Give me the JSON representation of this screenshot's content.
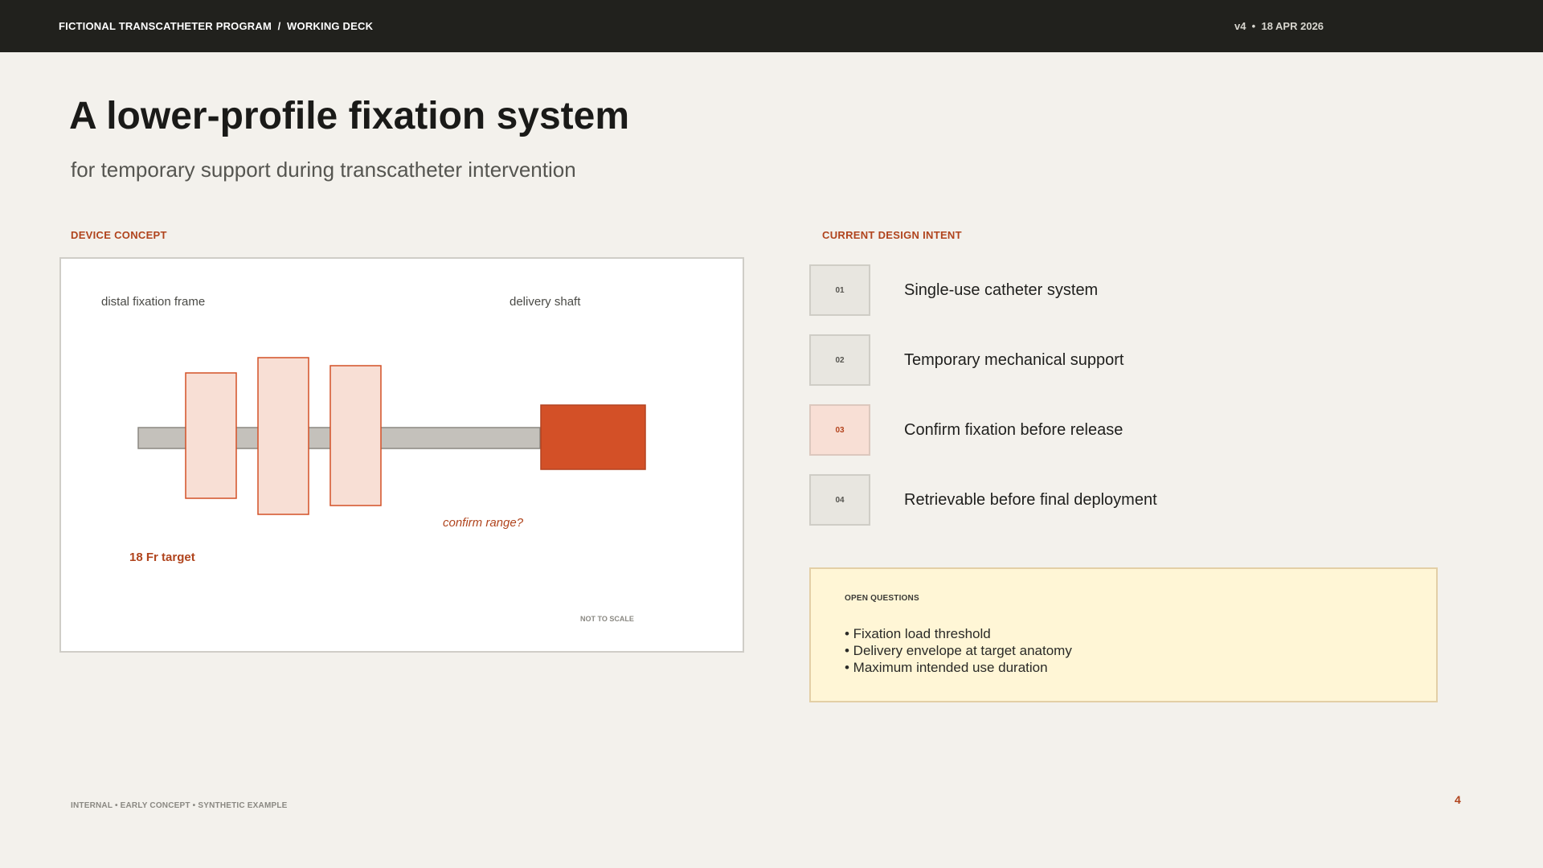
{
  "header": {
    "program": "FICTIONAL TRANSCATHETER PROGRAM  /  WORKING DECK",
    "version": "v4  •  18 APR 2026"
  },
  "slide": {
    "title": "A lower-profile fixation system",
    "subtitle": "for temporary support during transcatheter intervention"
  },
  "concept": {
    "section_label": "DEVICE CONCEPT",
    "label_frame": "distal fixation frame",
    "label_shaft": "delivery shaft",
    "annotation_range": "confirm range?",
    "annotation_target": "18 Fr target",
    "scale_note": "NOT TO SCALE"
  },
  "intent": {
    "section_label": "CURRENT DESIGN INTENT",
    "items": [
      {
        "num": "01",
        "text": "Single-use catheter system"
      },
      {
        "num": "02",
        "text": "Temporary mechanical support"
      },
      {
        "num": "03",
        "text": "Confirm fixation before release"
      },
      {
        "num": "04",
        "text": "Retrievable before final deployment"
      }
    ]
  },
  "questions": {
    "title": "OPEN QUESTIONS",
    "items": [
      "• Fixation load threshold",
      "• Delivery envelope at target anatomy",
      "• Maximum intended use duration"
    ]
  },
  "footer": {
    "note": "INTERNAL • EARLY CONCEPT • SYNTHETIC EXAMPLE",
    "page": "4"
  },
  "colors": {
    "accent": "#d35027",
    "accent_text": "#b0441d",
    "frame_fill": "#f8dfd5",
    "shaft": "#c4c1bb",
    "dark_bar": "#21211d"
  }
}
